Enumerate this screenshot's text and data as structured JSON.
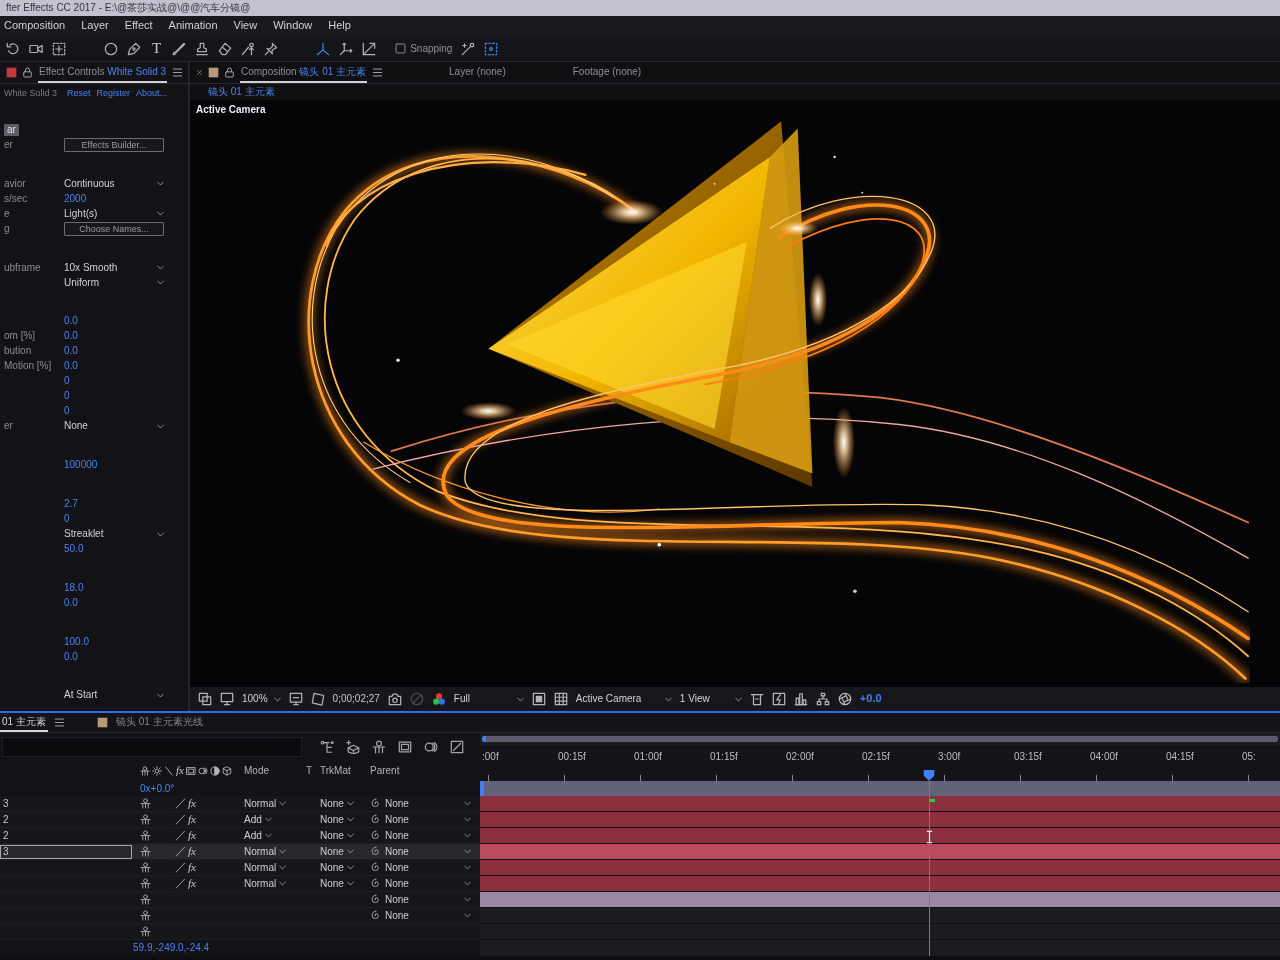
{
  "title_bar": {
    "text": "fter Effects CC 2017 - E:\\@茶莎实战@\\@@汽车分镜@"
  },
  "menu": [
    "Composition",
    "Layer",
    "Effect",
    "Animation",
    "View",
    "Window",
    "Help"
  ],
  "toolbar": {
    "type_tool": "T",
    "axis_modes": [
      {
        "selected": true
      },
      {
        "selected": false
      },
      {
        "selected": false
      }
    ],
    "snapping": {
      "label": "Snapping",
      "checked": false
    },
    "snap_options": [
      {
        "on": false
      },
      {
        "on": true
      }
    ]
  },
  "effect_controls": {
    "tab": {
      "label": "Effect Controls",
      "layer": "White Solid 3",
      "selected": true
    },
    "layer_line": "White Solid 3",
    "links": [
      "Reset",
      "Register",
      "About..."
    ],
    "groups": [
      [
        {
          "kind": "tag",
          "label": "ar"
        },
        {
          "kind": "button",
          "label": "er",
          "value": "Effects Builder..."
        }
      ],
      [
        {
          "kind": "dropdown",
          "label": "avior",
          "value": "Continuous"
        },
        {
          "kind": "number",
          "label": "s/sec",
          "value": "2000"
        },
        {
          "kind": "dropdown",
          "label": "e",
          "value": "Light(s)"
        },
        {
          "kind": "button",
          "label": "g",
          "value": "Choose Names..."
        }
      ],
      [
        {
          "kind": "dropdown",
          "label": "ubframe",
          "value": "10x Smooth"
        },
        {
          "kind": "dropdown",
          "value": "Uniform"
        }
      ],
      [
        {
          "kind": "number",
          "value": "0.0"
        },
        {
          "kind": "number",
          "label": "om [%]",
          "value": "0.0"
        },
        {
          "kind": "number",
          "label": "bution",
          "value": "0.0"
        },
        {
          "kind": "number",
          "label": "Motion [%]",
          "value": "0.0"
        },
        {
          "kind": "number",
          "value": "0"
        },
        {
          "kind": "number",
          "value": "0"
        },
        {
          "kind": "number",
          "value": "0"
        },
        {
          "kind": "dropdown",
          "label": "er",
          "value": "None"
        }
      ],
      [
        {
          "kind": "number",
          "value": "100000"
        }
      ],
      [
        {
          "kind": "number",
          "value": "2.7"
        },
        {
          "kind": "number",
          "value": "0"
        },
        {
          "kind": "dropdown",
          "value": "Streaklet"
        },
        {
          "kind": "number",
          "value": "50.0"
        }
      ],
      [
        {
          "kind": "number",
          "value": "18.0"
        },
        {
          "kind": "number",
          "value": "0.0"
        }
      ],
      [
        {
          "kind": "number",
          "value": "100.0"
        },
        {
          "kind": "number",
          "value": "0.0"
        }
      ],
      [
        {
          "kind": "dropdown",
          "value": "At Start"
        }
      ]
    ]
  },
  "composition": {
    "tabs": [
      {
        "label": "Composition",
        "comp": "镜头 01 主元素",
        "selected": true
      },
      {
        "label": "Layer (none)",
        "selected": false
      },
      {
        "label": "Footage (none)",
        "selected": false
      }
    ],
    "breadcrumb": "镜头 01 主元素",
    "view_label": "Active Camera"
  },
  "viewer_toolbar": {
    "zoom": "100%",
    "timecode": "0;00;02;27",
    "resolution": "Full",
    "camera": "Active Camera",
    "views": "1 View",
    "exposure": "+0.0"
  },
  "timeline": {
    "tabs": [
      {
        "label": "01 主元素",
        "selected": true
      },
      {
        "label": "镜头 01 主元素光线",
        "selected": false
      }
    ],
    "header_fx": "fx",
    "columns": {
      "mode": "Mode",
      "t": "T",
      "trkmat": "TrkMat",
      "parent": "Parent"
    },
    "property_value": "0x+0.0°",
    "layers": [
      {
        "name": "3",
        "selected": false,
        "effects": "fx",
        "mode": "Normal",
        "trkmat": "None",
        "parent": "None",
        "color": "#8c2f3e"
      },
      {
        "name": "2",
        "selected": false,
        "effects": "fx",
        "mode": "Add",
        "trkmat": "None",
        "parent": "None",
        "color": "#8c2f3e"
      },
      {
        "name": "2",
        "selected": false,
        "effects": "fx",
        "mode": "Add",
        "trkmat": "None",
        "parent": "None",
        "color": "#8c2f3e"
      },
      {
        "name": "3",
        "selected": true,
        "effects": "fx",
        "mode": "Normal",
        "trkmat": "None",
        "parent": "None",
        "color": "#bb4a5d"
      },
      {
        "selected": false,
        "effects": "fx",
        "mode": "Normal",
        "trkmat": "None",
        "parent": "None",
        "color": "#8c2f3e"
      },
      {
        "selected": false,
        "effects": "fx",
        "mode": "Normal",
        "trkmat": "None",
        "parent": "None",
        "color": "#8c2f3e"
      },
      {
        "selected": false,
        "parent": "None",
        "color": "#9a87a6"
      },
      {
        "selected": false,
        "parent": "None"
      },
      {
        "selected": false
      }
    ],
    "footer_value": "59.9,-249.0,-24.4",
    "ruler": [
      ":00f",
      "00:15f",
      "01:00f",
      "01:15f",
      "02:00f",
      "02:15f",
      "3:00f",
      "03:15f",
      "04:00f",
      "04:15f",
      "05:"
    ],
    "playhead": {
      "level": 0.561
    }
  }
}
